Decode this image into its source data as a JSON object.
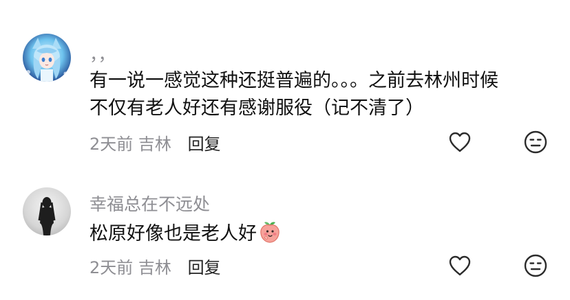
{
  "comments": [
    {
      "username": "，，",
      "text_line1": "有一说一感觉这种还挺普遍的。。。之前去林州时候",
      "text_line2": "不仅有老人好还有感谢服役（记不清了）",
      "time": "2天前",
      "location": "吉林",
      "reply_label": "回复",
      "avatar_icon": "anime-girl-avatar",
      "like_icon": "heart-outline-icon",
      "dislike_icon": "neutral-face-icon"
    },
    {
      "username": "幸福总在不远处",
      "text": "松原好像也是老人好",
      "emoji_icon": "peach-emoji",
      "time": "2天前",
      "location": "吉林",
      "reply_label": "回复",
      "avatar_icon": "silhouette-avatar",
      "like_icon": "heart-outline-icon",
      "dislike_icon": "neutral-face-icon"
    }
  ],
  "colors": {
    "text": "#111111",
    "muted": "#8e8e93",
    "icon": "#2b2b2b"
  }
}
